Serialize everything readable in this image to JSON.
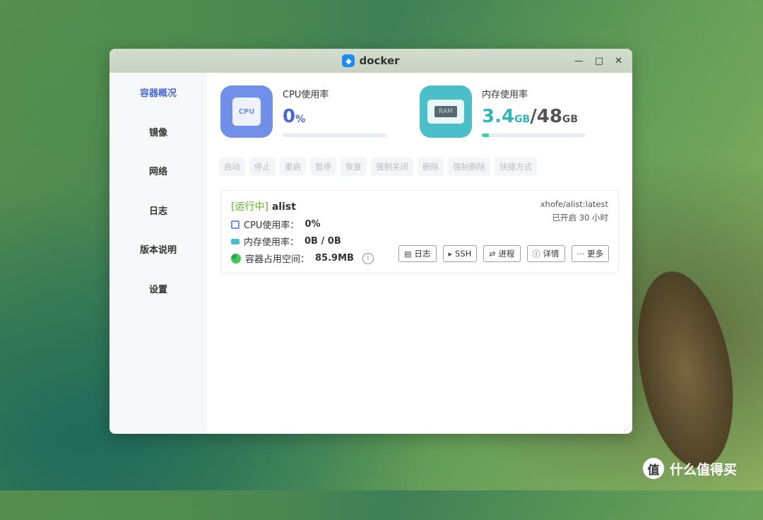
{
  "window": {
    "title": "docker"
  },
  "sidebar": {
    "items": [
      {
        "label": "容器概况",
        "active": true
      },
      {
        "label": "镜像"
      },
      {
        "label": "网络"
      },
      {
        "label": "日志"
      },
      {
        "label": "版本说明"
      },
      {
        "label": "设置"
      }
    ]
  },
  "cpu": {
    "label": "CPU使用率",
    "chip": "CPU",
    "value": "0",
    "unit": "%",
    "progress": 0,
    "color": "#4a67d6"
  },
  "memory": {
    "label": "内存使用率",
    "chip": "RAM",
    "used": "3.4",
    "used_unit": "GB",
    "sep": "/",
    "total": "48",
    "total_unit": "GB",
    "progress": 0.07,
    "color_used": "#2eb6b8",
    "color_total": "#555555"
  },
  "actions": [
    "启动",
    "停止",
    "重启",
    "暂停",
    "恢复",
    "强制关闭",
    "删除",
    "强制删除",
    "快捷方式"
  ],
  "container": {
    "status": "[运行中]",
    "name": "alist",
    "image": "xhofe/alist:latest",
    "uptime": "已开启 30 小时",
    "cpu_label": "CPU使用率：",
    "cpu_value": "0%",
    "mem_label": "内存使用率：",
    "mem_value": "0B / 0B",
    "disk_label": "容器占用空间：",
    "disk_value": "85.9MB",
    "buttons": [
      {
        "label": "日志",
        "icon": "log-icon"
      },
      {
        "label": "SSH",
        "icon": "terminal-icon"
      },
      {
        "label": "进程",
        "icon": "process-icon"
      },
      {
        "label": "详情",
        "icon": "info-icon"
      },
      {
        "label": "更多",
        "icon": "more-icon"
      }
    ]
  },
  "watermark": {
    "text": "什么值得买",
    "icon_glyph": "值"
  }
}
